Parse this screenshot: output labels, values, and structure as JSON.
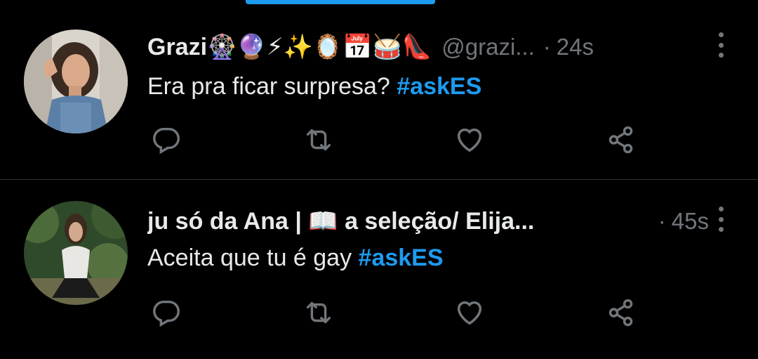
{
  "tweets": [
    {
      "name": "Grazi🎡🔮⚡✨🪞📅🥁👠",
      "handle": "@grazi...",
      "separator": "·",
      "time": "24s",
      "text": "Era pra ficar surpresa? ",
      "hashtag": "#askES"
    },
    {
      "name": "ju só da Ana | 📖 a seleção/ Elija...",
      "handle": "",
      "separator": "·",
      "time": "45s",
      "text": "Aceita que tu é gay ",
      "hashtag": "#askES"
    }
  ],
  "icons": {
    "reply": "comment-icon",
    "retweet": "retweet-icon",
    "like": "heart-icon",
    "share": "share-icon",
    "more": "more-vertical-icon"
  },
  "colors": {
    "background": "#000000",
    "text": "#e7e9ea",
    "secondary": "#71767b",
    "accent": "#1d9bf0",
    "divider": "#2f3336"
  }
}
